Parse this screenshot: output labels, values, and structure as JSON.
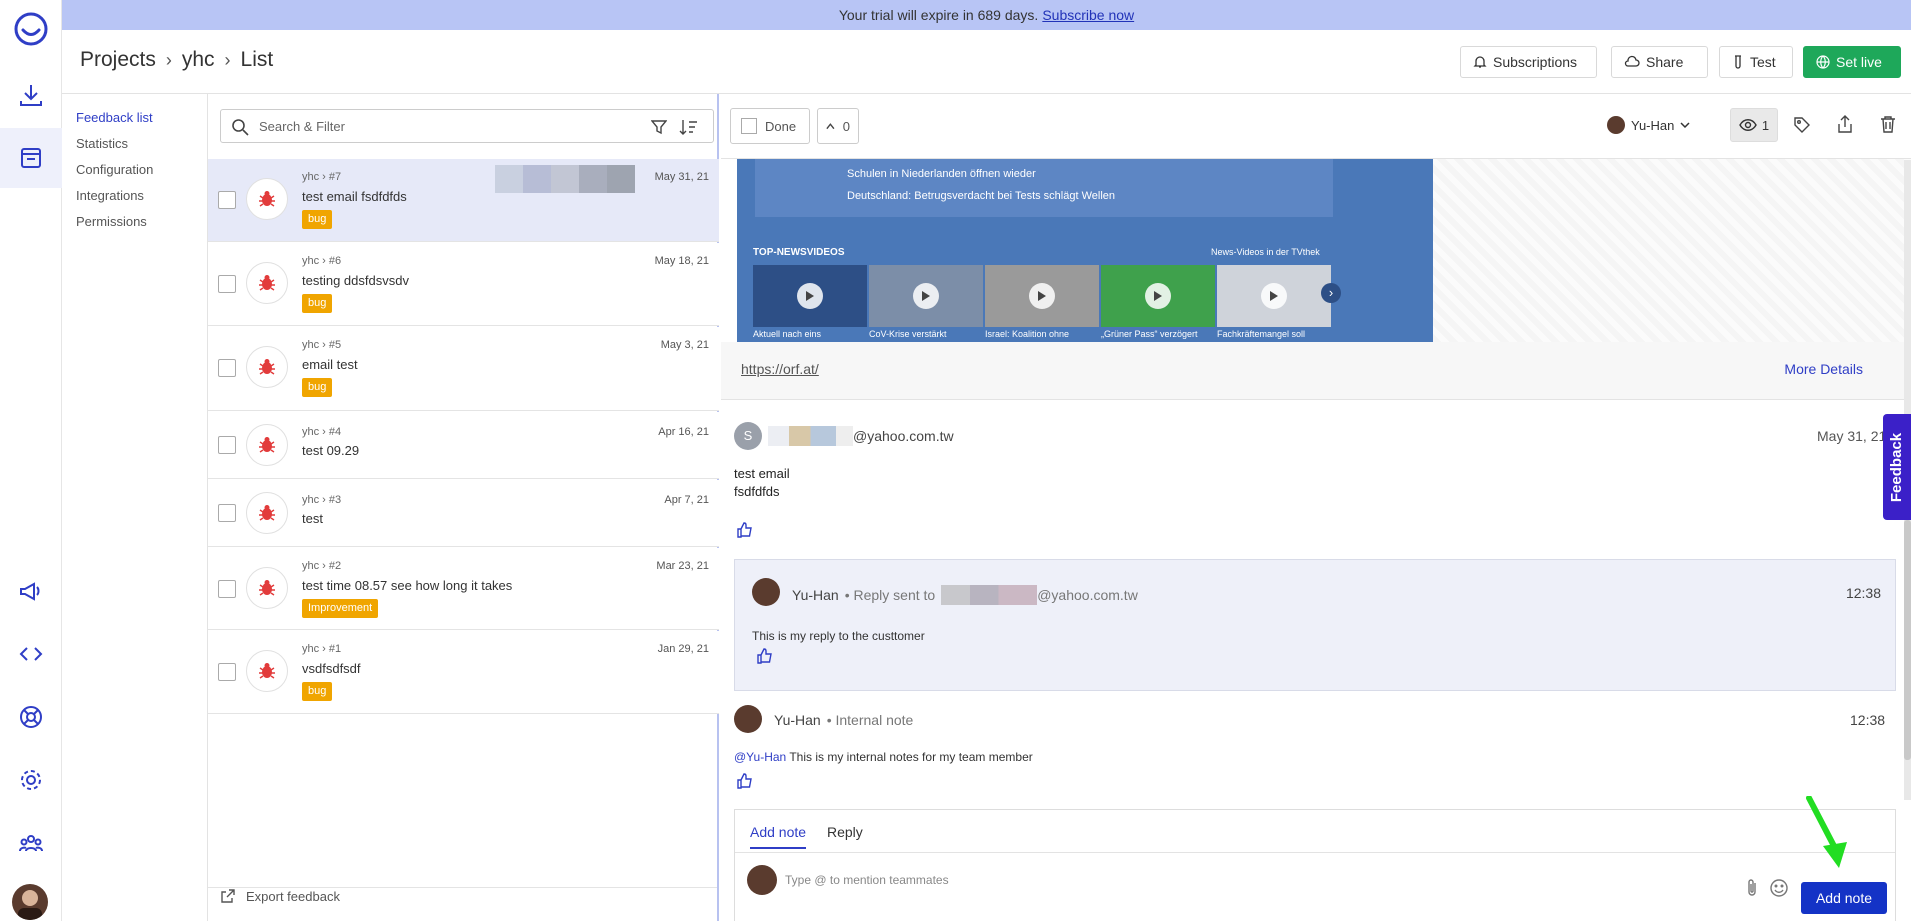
{
  "banner": {
    "text": "Your trial will expire in 689 days.",
    "link": "Subscribe now"
  },
  "breadcrumb": {
    "root": "Projects",
    "project": "yhc",
    "page": "List"
  },
  "header_buttons": {
    "subscriptions": "Subscriptions",
    "share": "Share",
    "test": "Test",
    "set_live": "Set live"
  },
  "subnav": [
    "Feedback list",
    "Statistics",
    "Configuration",
    "Integrations",
    "Permissions"
  ],
  "search": {
    "placeholder": "Search & Filter"
  },
  "feedback_items": [
    {
      "ref": "yhc › #7",
      "title": "test email fsdfdfds",
      "tag": "bug",
      "date": "May 31, 21"
    },
    {
      "ref": "yhc › #6",
      "title": "testing ddsfdsvsdv",
      "tag": "bug",
      "date": "May 18, 21"
    },
    {
      "ref": "yhc › #5",
      "title": "email test",
      "tag": "bug",
      "date": "May 3, 21"
    },
    {
      "ref": "yhc › #4",
      "title": "test 09.29",
      "tag": "",
      "date": "Apr 16, 21"
    },
    {
      "ref": "yhc › #3",
      "title": "test",
      "tag": "",
      "date": "Apr 7, 21"
    },
    {
      "ref": "yhc › #2",
      "title": "test time 08.57 see how long it takes",
      "tag": "Improvement",
      "date": "Mar 23, 21"
    },
    {
      "ref": "yhc › #1",
      "title": "vsdfsdfsdf",
      "tag": "bug",
      "date": "Jan 29, 21"
    }
  ],
  "export_label": "Export feedback",
  "toolbar": {
    "done_label": "Done",
    "vote_count": "0",
    "assignee": "Yu-Han",
    "views": "1"
  },
  "screenshot": {
    "lines": [
      "Schulen in Niederlanden öffnen wieder",
      "Deutschland: Betrugsverdacht bei Tests schlägt Wellen"
    ],
    "section": "TOP-NEWSVIDEOS",
    "section_right": "News-Videos in der TVthek",
    "captions": [
      "Aktuell nach eins",
      "CoV-Krise verstärkt",
      "Israel: Koalition ohne",
      "„Grüner Pass“ verzögert",
      "Fachkräftemangel soll"
    ]
  },
  "url": "https://orf.at/",
  "more_details": "More Details",
  "message": {
    "avatar_letter": "S",
    "email_suffix": "@yahoo.com.tw",
    "date": "May 31, 21",
    "body_line1": "test email",
    "body_line2": "fsdfdfds"
  },
  "reply": {
    "author": "Yu-Han",
    "meta": "• Reply sent to",
    "email_suffix": "@yahoo.com.tw",
    "time": "12:38",
    "body": "This is my reply to the custtomer"
  },
  "note": {
    "author": "Yu-Han",
    "meta": "• Internal note",
    "time": "12:38",
    "mention": "@Yu-Han",
    "body": "This is my internal notes for my team member"
  },
  "composer": {
    "tab_note": "Add note",
    "tab_reply": "Reply",
    "placeholder": "Type @ to mention teammates",
    "submit": "Add note"
  },
  "feedback_tab": "Feedback",
  "colors": {
    "accent": "#2f3ec6",
    "live": "#1ea85a",
    "bug_tag": "#f0a500",
    "cta": "#1433c6"
  }
}
